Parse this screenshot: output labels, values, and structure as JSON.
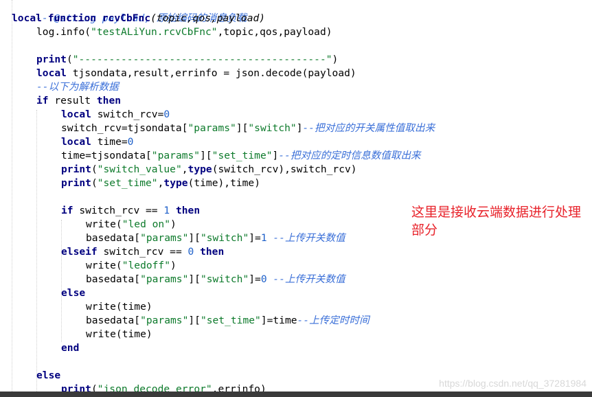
{
  "code": {
    "l1": "-- @string payload, 原始编码的消息负载",
    "l2_kw1": "local",
    "l2_kw2": "function",
    "l2_fn": "rcvCbFnc",
    "l2_rest": "(topic,qos,payload)",
    "l3_a": "log.info(",
    "l3_str": "\"testALiYun.rcvCbFnc\"",
    "l3_b": ",topic,qos,payload)",
    "l5_kw": "print",
    "l5_a": "(",
    "l5_str": "\"-----------------------------------------\"",
    "l5_b": ")",
    "l6_kw": "local",
    "l6_rest": " tjsondata,result,errinfo = json.decode(payload)",
    "l7": "--以下为解析数据",
    "l8_kw1": "if",
    "l8_mid": " result ",
    "l8_kw2": "then",
    "l9_kw": "local",
    "l9_a": " switch_rcv=",
    "l9_num": "0",
    "l10_a": "switch_rcv=tjsondata[",
    "l10_s1": "\"params\"",
    "l10_b": "][",
    "l10_s2": "\"switch\"",
    "l10_c": "]",
    "l10_cm": "--把对应的开关属性值取出来",
    "l11_kw": "local",
    "l11_a": " time=",
    "l11_num": "0",
    "l12_a": "time=tjsondata[",
    "l12_s1": "\"params\"",
    "l12_b": "][",
    "l12_s2": "\"set_time\"",
    "l12_c": "]",
    "l12_cm": "--把对应的定时信息数值取出来",
    "l13_kw": "print",
    "l13_a": "(",
    "l13_str": "\"switch_value\"",
    "l13_b": ",",
    "l13_kw2": "type",
    "l13_c": "(switch_rcv),switch_rcv)",
    "l14_kw": "print",
    "l14_a": "(",
    "l14_str": "\"set_time\"",
    "l14_b": ",",
    "l14_kw2": "type",
    "l14_c": "(time),time)",
    "l16_kw1": "if",
    "l16_a": " switch_rcv == ",
    "l16_num": "1",
    "l16_sp": " ",
    "l16_kw2": "then",
    "l17_a": "write(",
    "l17_str": "\"led on\"",
    "l17_b": ")",
    "l18_a": "basedata[",
    "l18_s1": "\"params\"",
    "l18_b": "][",
    "l18_s2": "\"switch\"",
    "l18_c": "]=",
    "l18_num": "1",
    "l18_cm": " --上传开关数值",
    "l19_kw1": "elseif",
    "l19_a": " switch_rcv == ",
    "l19_num": "0",
    "l19_sp": " ",
    "l19_kw2": "then",
    "l20_a": "write(",
    "l20_str": "\"ledoff\"",
    "l20_b": ")",
    "l21_a": "basedata[",
    "l21_s1": "\"params\"",
    "l21_b": "][",
    "l21_s2": "\"switch\"",
    "l21_c": "]=",
    "l21_num": "0",
    "l21_cm": " --上传开关数值",
    "l22_kw": "else",
    "l23": "write(time)",
    "l24_a": "basedata[",
    "l24_s1": "\"params\"",
    "l24_b": "][",
    "l24_s2": "\"set_time\"",
    "l24_c": "]=time",
    "l24_cm": "--上传定时时间",
    "l25": "write(time)",
    "l26_kw": "end",
    "l28_kw": "else",
    "l29_kw": "print",
    "l29_a": "(",
    "l29_str": "\"json_decode_error\"",
    "l29_b": ",errinfo)"
  },
  "annotation": "这里是接收云端数据进行处理部分",
  "watermark": "https://blog.csdn.net/qq_37281984",
  "colors": {
    "keyword": "#00007f",
    "comment": "#3a6fd8",
    "string": "#0d7a2b",
    "number": "#1c5fc9",
    "annotation": "#e8232b"
  }
}
